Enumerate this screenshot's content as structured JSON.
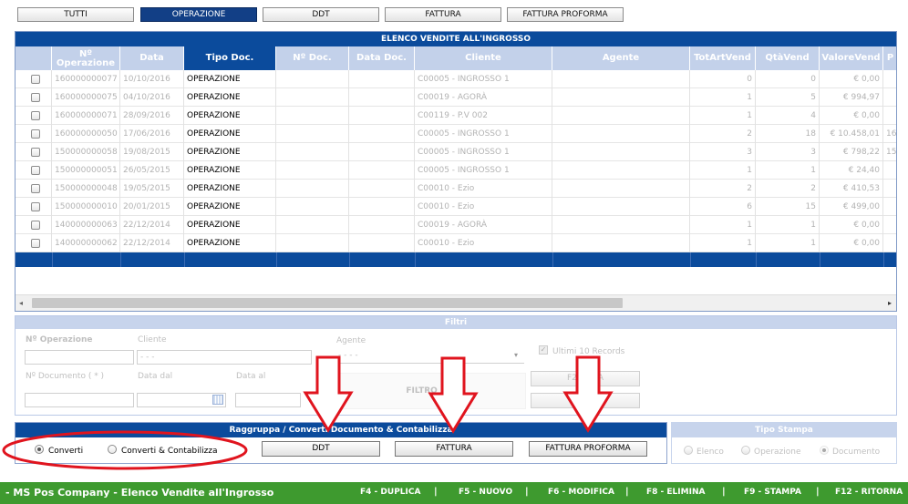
{
  "tabs": [
    "TUTTI",
    "OPERAZIONE",
    "DDT",
    "FATTURA",
    "FATTURA PROFORMA"
  ],
  "active_tab": "OPERAZIONE",
  "grid": {
    "title": "ELENCO VENDITE ALL'INGROSSO",
    "headers": [
      "Nº Operazione",
      "Data",
      "Tipo Doc.",
      "Nº Doc.",
      "Data Doc.",
      "Cliente",
      "Agente",
      "TotArtVend",
      "QtàVend",
      "ValoreVend",
      "P"
    ],
    "rows": [
      {
        "op": "160000000077",
        "data": "10/10/2016",
        "tipo": "OPERAZIONE",
        "cliente": "C00005 - INGROSSO 1",
        "tot": "0",
        "qta": "0",
        "valore": "€ 0,00",
        "p": ""
      },
      {
        "op": "160000000075",
        "data": "04/10/2016",
        "tipo": "OPERAZIONE",
        "cliente": "C00019 - AGORÀ",
        "tot": "1",
        "qta": "5",
        "valore": "€ 994,97",
        "p": ""
      },
      {
        "op": "160000000071",
        "data": "28/09/2016",
        "tipo": "OPERAZIONE",
        "cliente": "C00119 - P.V 002",
        "tot": "1",
        "qta": "4",
        "valore": "€ 0,00",
        "p": ""
      },
      {
        "op": "160000000050",
        "data": "17/06/2016",
        "tipo": "OPERAZIONE",
        "cliente": "C00005 - INGROSSO 1",
        "tot": "2",
        "qta": "18",
        "valore": "€ 10.458,01",
        "p": "16"
      },
      {
        "op": "150000000058",
        "data": "19/08/2015",
        "tipo": "OPERAZIONE",
        "cliente": "C00005 - INGROSSO 1",
        "tot": "3",
        "qta": "3",
        "valore": "€ 798,22",
        "p": "15"
      },
      {
        "op": "150000000051",
        "data": "26/05/2015",
        "tipo": "OPERAZIONE",
        "cliente": "C00005 - INGROSSO 1",
        "tot": "1",
        "qta": "1",
        "valore": "€ 24,40",
        "p": ""
      },
      {
        "op": "150000000048",
        "data": "19/05/2015",
        "tipo": "OPERAZIONE",
        "cliente": "C00010 - Ezio",
        "tot": "2",
        "qta": "2",
        "valore": "€ 410,53",
        "p": ""
      },
      {
        "op": "150000000010",
        "data": "20/01/2015",
        "tipo": "OPERAZIONE",
        "cliente": "C00010 - Ezio",
        "tot": "6",
        "qta": "15",
        "valore": "€ 499,00",
        "p": ""
      },
      {
        "op": "140000000063",
        "data": "22/12/2014",
        "tipo": "OPERAZIONE",
        "cliente": "C00019 - AGORÀ",
        "tot": "1",
        "qta": "1",
        "valore": "€ 0,00",
        "p": ""
      },
      {
        "op": "140000000062",
        "data": "22/12/2014",
        "tipo": "OPERAZIONE",
        "cliente": "C00010 - Ezio",
        "tot": "1",
        "qta": "1",
        "valore": "€ 0,00",
        "p": ""
      }
    ]
  },
  "filters": {
    "title": "Filtri",
    "op_label": "Nº Operazione",
    "cliente_label": "Cliente",
    "cliente_value": "- - -",
    "agente_label": "Agente",
    "agente_value": "- - - -",
    "ultimi_label": "Ultimi 10 Records",
    "doc_label": "Nº Documento ( * )",
    "data_dal_label": "Data dal",
    "data_al_label": "Data al",
    "filtro_btn": "FILTRO ART",
    "f2_btn": "F2",
    "f2_suffix": "RA",
    "f3_btn": "F3",
    "f3_suffix": "A"
  },
  "group_panel": {
    "title": "Raggruppa / Converti Documento & Contabilizza",
    "radio1": "Converti",
    "radio2": "Converti & Contabilizza",
    "btn_ddt": "DDT",
    "btn_fattura": "FATTURA",
    "btn_proforma": "FATTURA PROFORMA"
  },
  "stampa_panel": {
    "title": "Tipo Stampa",
    "opt1": "Elenco",
    "opt2": "Operazione",
    "opt3": "Documento"
  },
  "footer": {
    "title": "- MS Pos Company - Elenco Vendite all'Ingrosso",
    "keys": [
      "F4 - DUPLICA",
      "F5 - NUOVO",
      "F6 - MODIFICA",
      "F8 - ELIMINA",
      "F9 - STAMPA",
      "F12 - RITORNA"
    ],
    "sep": "|"
  },
  "colors": {
    "header_blue": "#0b4b9c",
    "footer_green": "#3e9a2f",
    "annotation_red": "#e0141e"
  }
}
